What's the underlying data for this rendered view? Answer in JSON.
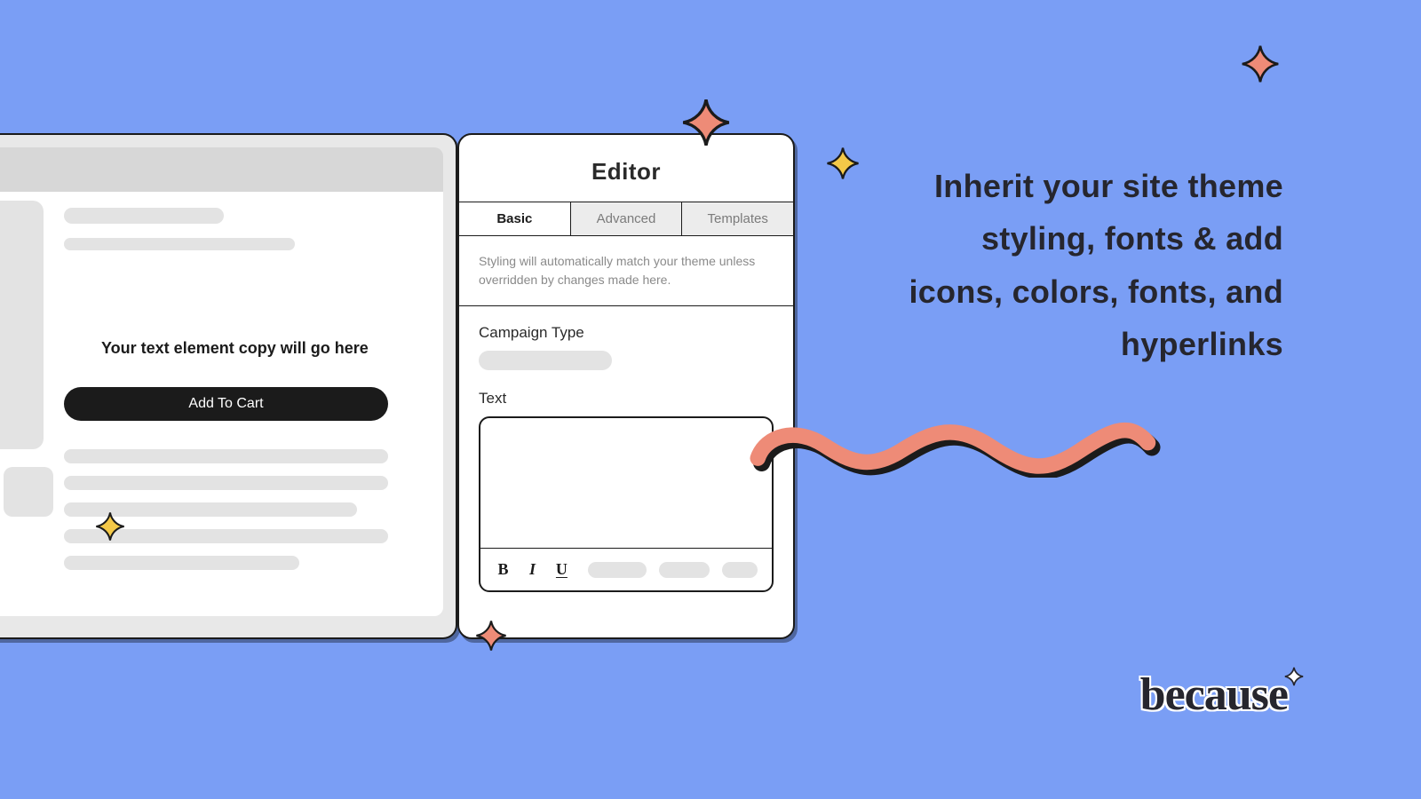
{
  "preview": {
    "placeholder_text": "Your text element copy will go here",
    "cta_label": "Add To Cart"
  },
  "editor": {
    "title": "Editor",
    "tabs": {
      "basic": "Basic",
      "advanced": "Advanced",
      "templates": "Templates"
    },
    "helper_text": "Styling will automatically match your theme unless overridden by changes made here.",
    "campaign_type_label": "Campaign Type",
    "text_label": "Text",
    "toolbar": {
      "bold": "B",
      "italic": "I",
      "underline": "U"
    }
  },
  "headline": {
    "text": "Inherit your site theme styling, fonts & add icons, colors, fonts, and hyperlinks"
  },
  "brand": {
    "name": "because"
  },
  "colors": {
    "bg": "#7A9EF5",
    "ink": "#1B1B1B",
    "salmon": "#EE8B77",
    "gold": "#F4C948"
  }
}
